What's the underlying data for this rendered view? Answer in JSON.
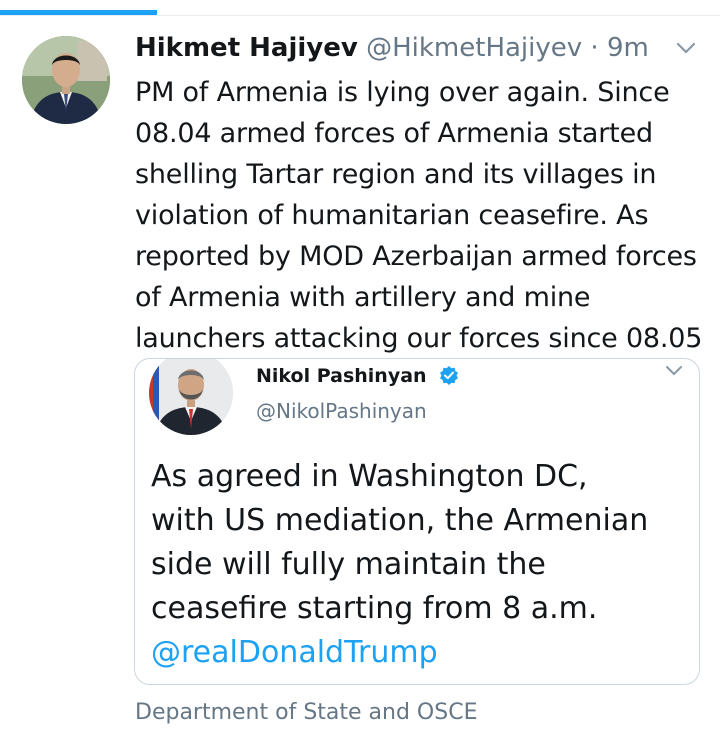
{
  "tweet": {
    "author_name": "Hikmet Hajiyev",
    "author_handle": "@HikmetHajiyev",
    "separator": "·",
    "time_ago": "9m",
    "text_lines": [
      "PM of Armenia is lying over again. Since",
      "08.04 armed forces of Armenia started",
      "shelling Tartar region and its villages in",
      "violation of humanitarian ceasefire. As",
      "reported by MOD Azerbaijan armed forces",
      "of Armenia with artillery and mine",
      "launchers attacking our forces since 08.05"
    ],
    "quoted": {
      "author_name": "Nikol Pashinyan",
      "author_handle": "@NikolPashinyan",
      "text_lines": [
        "As agreed in Washington DC,",
        "with US mediation, the Armenian",
        "side will fully maintain the",
        "ceasefire starting from 8 a.m."
      ],
      "mention": "@realDonaldTrump"
    },
    "footer_tag": "Department of State and OSCE"
  },
  "colors": {
    "accent": "#1da1f2",
    "text_primary": "#14171a",
    "text_secondary": "#657786",
    "border": "#ccd6dd"
  },
  "icons": {
    "menu": "chevron-down-icon",
    "verified": "verified-badge-icon"
  }
}
